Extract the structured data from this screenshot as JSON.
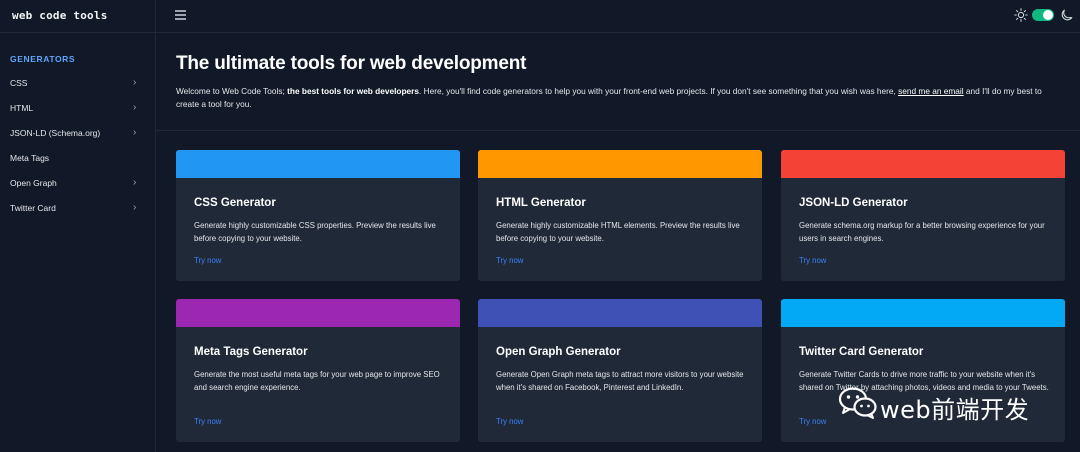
{
  "sidebar": {
    "logo": "web code tools",
    "heading": "GENERATORS",
    "items": [
      {
        "label": "CSS",
        "chevron": "›"
      },
      {
        "label": "HTML",
        "chevron": "›"
      },
      {
        "label": "JSON-LD (Schema.org)",
        "chevron": "›"
      },
      {
        "label": "Meta Tags",
        "chevron": ""
      },
      {
        "label": "Open Graph",
        "chevron": "›"
      },
      {
        "label": "Twitter Card",
        "chevron": "›"
      }
    ]
  },
  "topbar": {
    "menu_icon": "hamburger-menu-icon",
    "theme_light_icon": "sun-icon",
    "theme_dark_icon": "moon-icon",
    "dark_mode_enabled": true,
    "toggle_color": "#10b981"
  },
  "hero": {
    "title": "The ultimate tools for web development",
    "intro_start": "Welcome to Web Code Tools; ",
    "intro_bold": "the best tools for web developers",
    "intro_mid": ". Here, you'll find code generators to help you with your front-end web projects. If you don't see something that you wish was here, ",
    "intro_link": "send me an email",
    "intro_end": " and I'll do my best to create a tool for you."
  },
  "cards": [
    {
      "title": "CSS Generator",
      "description": "Generate highly customizable CSS properties. Preview the results live before copying to your website.",
      "cta": "Try now",
      "color": "#2196f3"
    },
    {
      "title": "HTML Generator",
      "description": "Generate highly customizable HTML elements. Preview the results live before copying to your website.",
      "cta": "Try now",
      "color": "#ff9800"
    },
    {
      "title": "JSON-LD Generator",
      "description": "Generate schema.org markup for a better browsing experience for your users in search engines.",
      "cta": "Try now",
      "color": "#f44336"
    },
    {
      "title": "Meta Tags Generator",
      "description": "Generate the most useful meta tags for your web page to improve SEO and search engine experience.",
      "cta": "Try now",
      "color": "#9c27b0"
    },
    {
      "title": "Open Graph Generator",
      "description": "Generate Open Graph meta tags to attract more visitors to your website when it's shared on Facebook, Pinterest and LinkedIn.",
      "cta": "Try now",
      "color": "#3f51b5"
    },
    {
      "title": "Twitter Card Generator",
      "description": "Generate Twitter Cards to drive more traffic to your website when it's shared on Twitter by attaching photos, videos and media to your Tweets.",
      "cta": "Try now",
      "color": "#03a9f4"
    }
  ],
  "watermark": {
    "icon": "wechat-icon",
    "text": "web前端开发"
  }
}
